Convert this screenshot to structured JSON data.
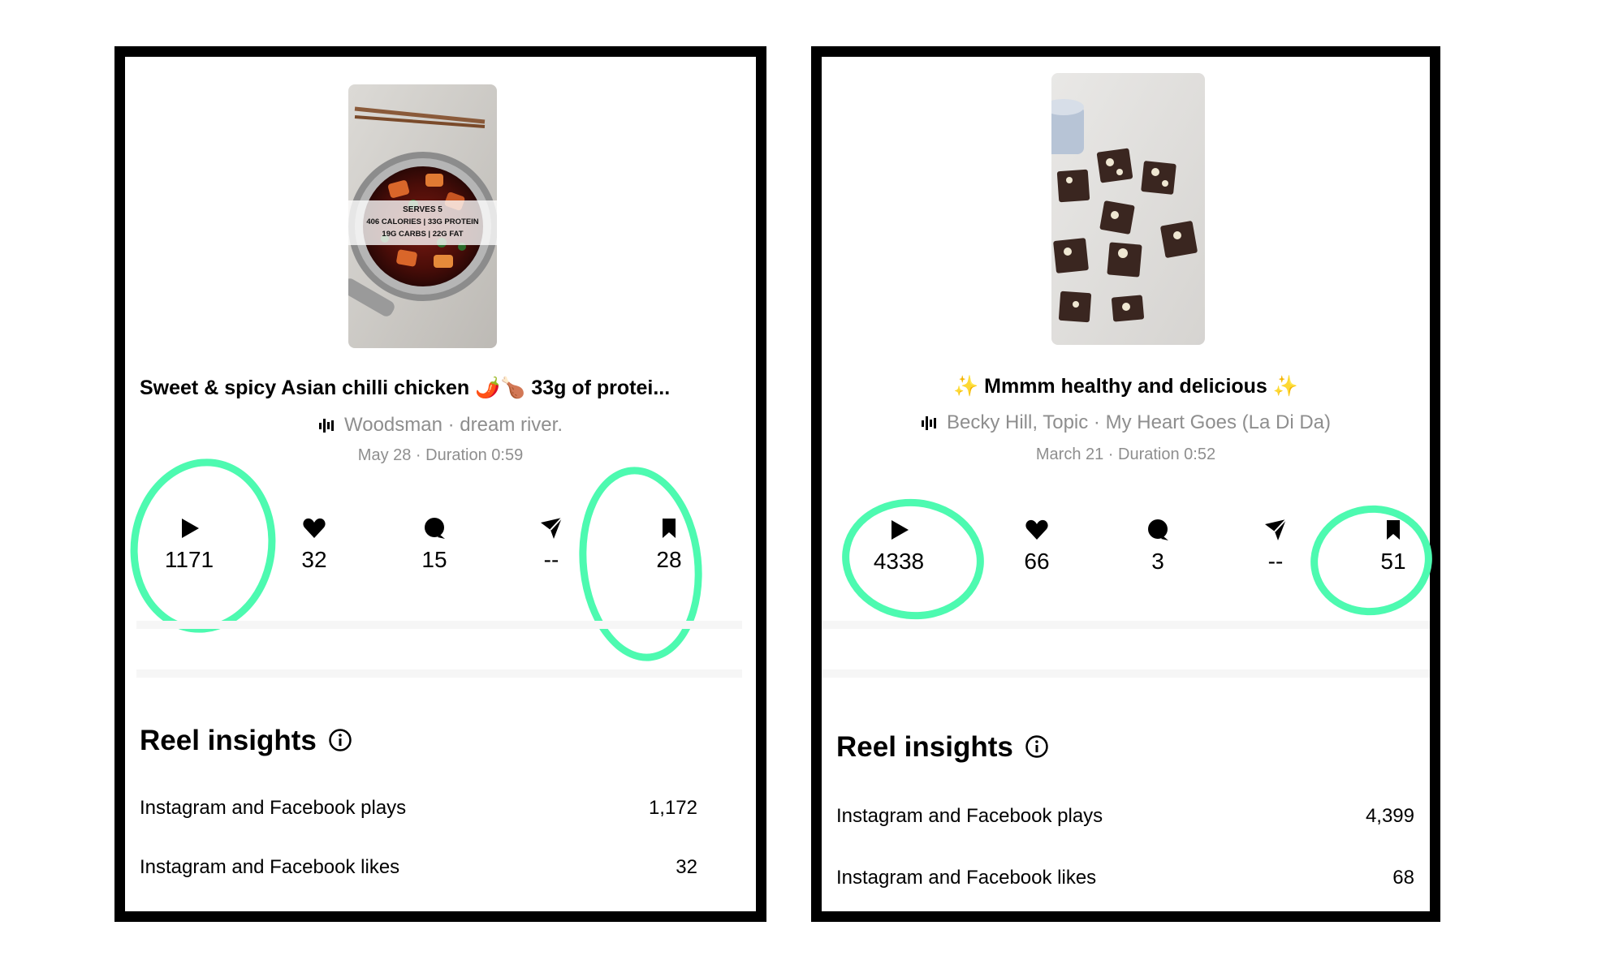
{
  "reels": [
    {
      "title": "Sweet & spicy Asian chilli chicken 🌶️🍗 33g of protei...",
      "audio": "Woodsman · dream river.",
      "meta": "May 28 · Duration 0:59",
      "thumbnail_text": [
        "SERVES 5",
        "406 CALORIES | 33G PROTEIN",
        "19G CARBS | 22G FAT"
      ],
      "stats": {
        "plays": "1171",
        "likes": "32",
        "comments": "15",
        "shares": "--",
        "saves": "28"
      },
      "insights_title": "Reel insights",
      "insights": [
        {
          "label": "Instagram and Facebook plays",
          "value": "1,172"
        },
        {
          "label": "Instagram and Facebook likes",
          "value": "32"
        }
      ]
    },
    {
      "title": "✨ Mmmm healthy and delicious ✨",
      "audio": "Becky Hill, Topic · My Heart Goes (La Di Da)",
      "meta": "March 21 · Duration 0:52",
      "stats": {
        "plays": "4338",
        "likes": "66",
        "comments": "3",
        "shares": "--",
        "saves": "51"
      },
      "insights_title": "Reel insights",
      "insights": [
        {
          "label": "Instagram and Facebook plays",
          "value": "4,399"
        },
        {
          "label": "Instagram and Facebook likes",
          "value": "68"
        }
      ]
    }
  ],
  "colors": {
    "highlight": "#4dfab0",
    "muted_text": "#8e8e8e",
    "border": "#000000"
  },
  "icons": [
    "play-icon",
    "heart-icon",
    "comment-icon",
    "share-icon",
    "bookmark-icon",
    "audio-wave-icon",
    "info-icon"
  ]
}
